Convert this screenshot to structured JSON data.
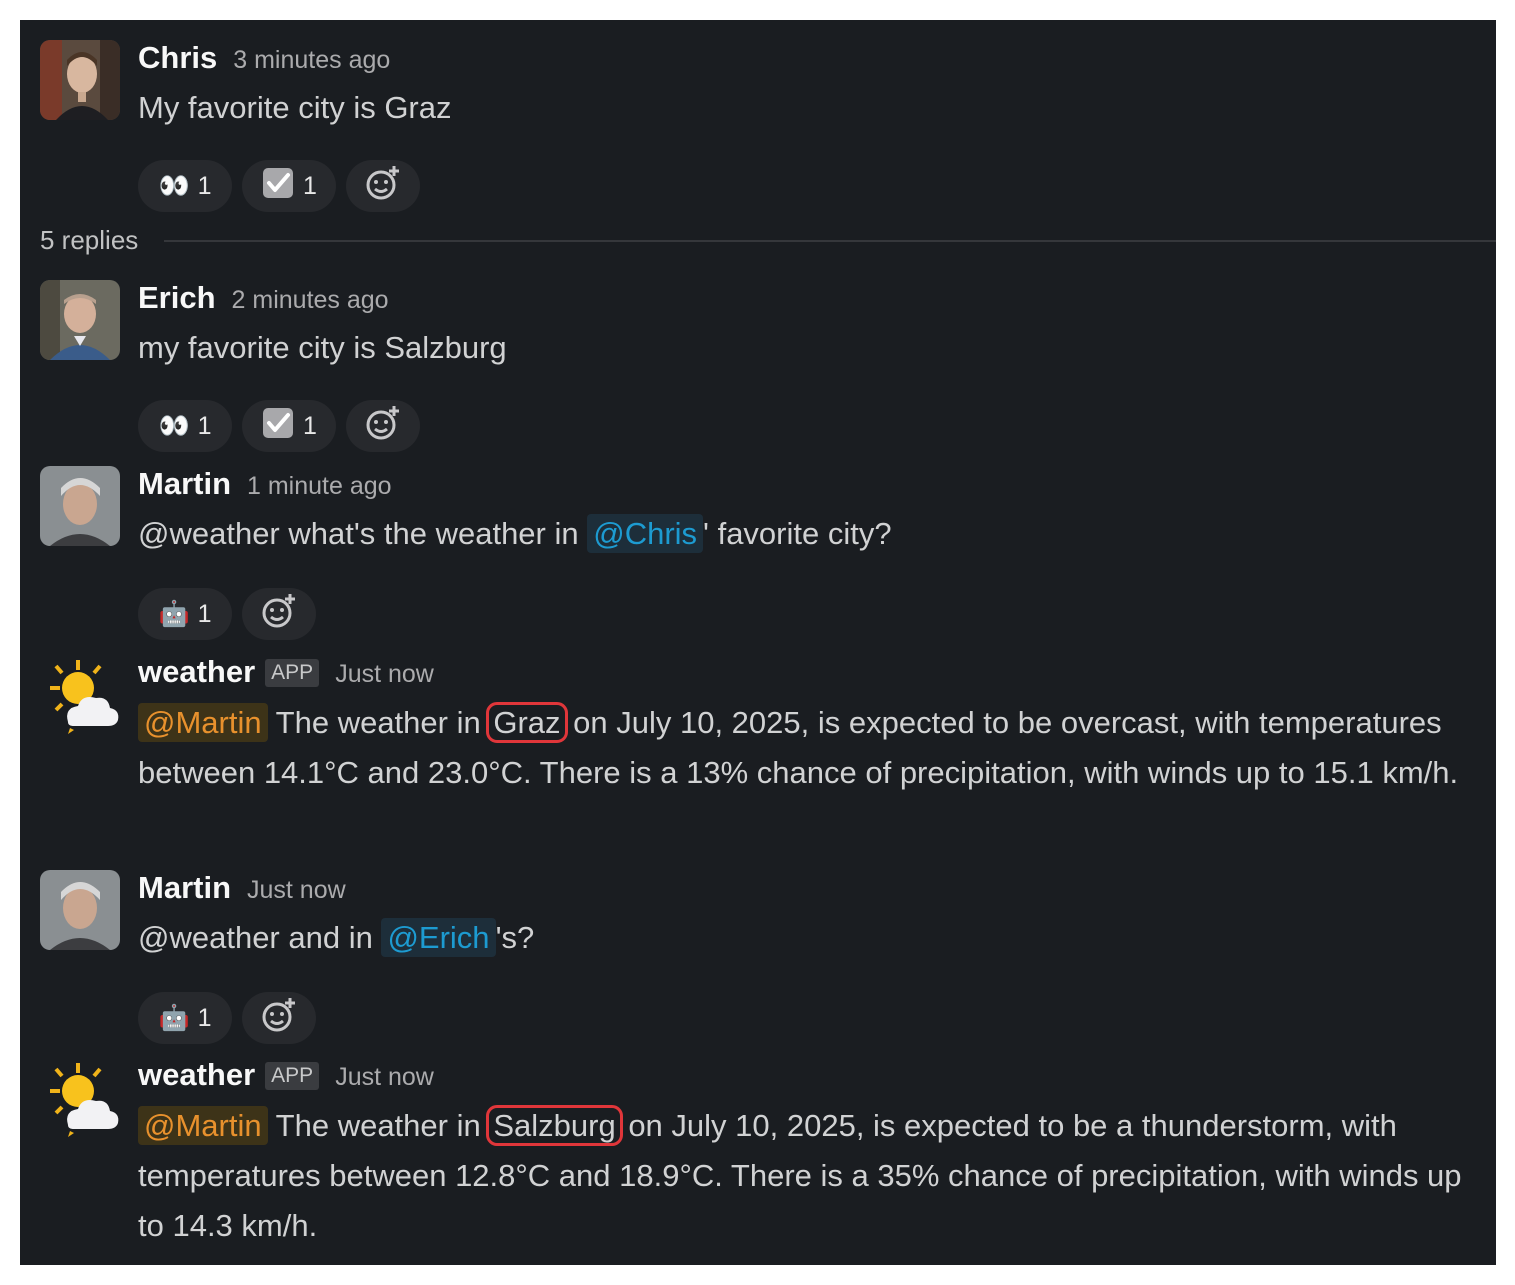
{
  "thread": {
    "replies_label": "5 replies",
    "messages": [
      {
        "author": "Chris",
        "time": "3 minutes ago",
        "text": "My favorite city is Graz",
        "reactions": [
          {
            "emoji": "👀",
            "icon": "eyes-icon",
            "count": "1"
          },
          {
            "emoji": "✔",
            "icon": "check-icon",
            "count": "1"
          }
        ]
      },
      {
        "author": "Erich",
        "time": "2 minutes ago",
        "text": "my favorite city is Salzburg",
        "reactions": [
          {
            "emoji": "👀",
            "icon": "eyes-icon",
            "count": "1"
          },
          {
            "emoji": "✔",
            "icon": "check-icon",
            "count": "1"
          }
        ]
      },
      {
        "author": "Martin",
        "time": "1 minute ago",
        "text_before": "@weather what's the weather in ",
        "mention": "@Chris",
        "text_after": "' favorite city?",
        "reactions": [
          {
            "emoji": "🤖",
            "icon": "robot-icon",
            "count": "1"
          }
        ]
      },
      {
        "author": "weather",
        "badge": "APP",
        "time": "Just now",
        "mention": "@Martin",
        "text_before": " The weather in ",
        "city": "Graz",
        "text_after": " on July 10, 2025, is expected to be overcast, with temperatures between 14.1°C and 23.0°C. There is a 13% chance of precipitation, with winds up to 15.1 km/h."
      },
      {
        "author": "Martin",
        "time": "Just now",
        "text_before": "@weather and in ",
        "mention": "@Erich",
        "text_after": "'s?",
        "reactions": [
          {
            "emoji": "🤖",
            "icon": "robot-icon",
            "count": "1"
          }
        ]
      },
      {
        "author": "weather",
        "badge": "APP",
        "time": "Just now",
        "mention": "@Martin",
        "text_before": " The weather in ",
        "city": "Salzburg",
        "text_after": " on July 10, 2025, is expected to be a thunderstorm, with temperatures between 12.8°C and 18.9°C. There is a 35% chance of precipitation, with winds up to 14.3 km/h."
      }
    ]
  },
  "colors": {
    "background": "#1a1d21",
    "mention_blue": "#1d9bd1",
    "mention_yellow": "#e8912d",
    "highlight_box": "#e0363a"
  }
}
